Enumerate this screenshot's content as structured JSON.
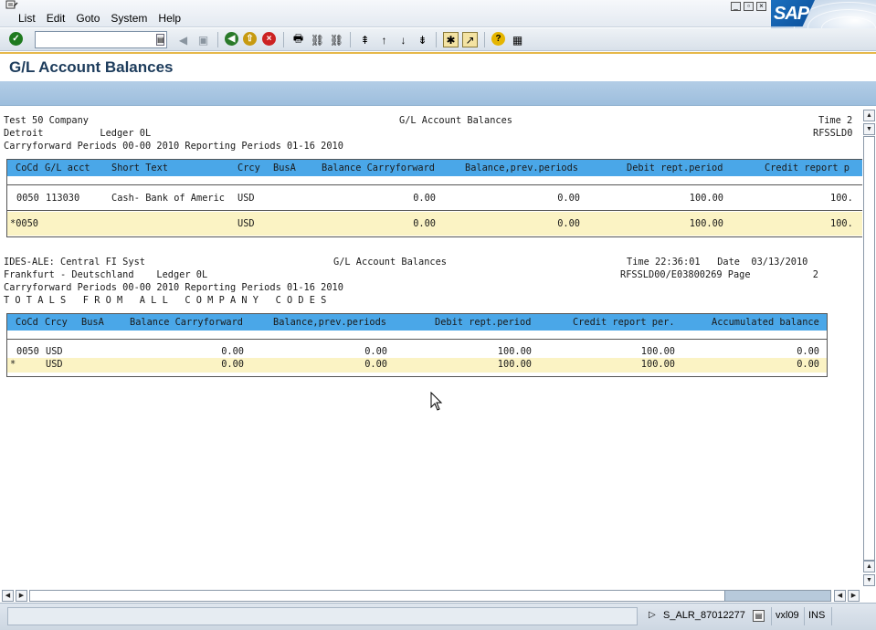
{
  "menubar": {
    "items": [
      "List",
      "Edit",
      "Goto",
      "System",
      "Help"
    ],
    "logo": "SAP"
  },
  "toolbar": {
    "command_value": "",
    "icons": [
      "enter-icon",
      "command-dropdown-icon",
      "back-triangle-icon",
      "save-icon",
      "back-icon",
      "exit-icon",
      "cancel-icon",
      "print-icon",
      "find-icon",
      "find-next-icon",
      "first-page-icon",
      "previous-page-icon",
      "next-page-icon",
      "last-page-icon",
      "create-session-icon",
      "shortcut-icon",
      "help-icon",
      "layout-icon"
    ]
  },
  "title": "G/L Account Balances",
  "report1": {
    "header_left": [
      "Test 50 Company",
      "Detroit          Ledger 0L",
      "Carryforward Periods 00-00 2010 Reporting Periods 01-16 2010"
    ],
    "header_center": "G/L Account Balances",
    "header_right": [
      "Time 2",
      "RFSSLD0"
    ],
    "columns": [
      "CoCd",
      "G/L acct",
      "Short Text",
      "Crcy",
      "BusA",
      "Balance Carryforward",
      "Balance,prev.periods",
      "Debit rept.period",
      "Credit report p"
    ],
    "rows": [
      {
        "cocd": "0050",
        "glacct": "113030",
        "short_text": "Cash- Bank of Americ",
        "crcy": "USD",
        "busa": "",
        "bal_cf": "0.00",
        "bal_prev": "0.00",
        "debit": "100.00",
        "credit": "100."
      }
    ],
    "total": {
      "cocd": "*0050",
      "crcy": "USD",
      "bal_cf": "0.00",
      "bal_prev": "0.00",
      "debit": "100.00",
      "credit": "100."
    }
  },
  "report2": {
    "header_left": [
      "IDES-ALE: Central FI Syst",
      "Frankfurt - Deutschland    Ledger 0L",
      "Carryforward Periods 00-00 2010 Reporting Periods 01-16 2010",
      "T O T A L S   F R O M   A L L   C O M P A N Y   C O D E S"
    ],
    "header_center": "G/L Account Balances",
    "time_line": "Time 22:36:01   Date  03/13/2010",
    "page_line": "RFSSLD00/E03800269 Page           2",
    "columns": [
      "CoCd",
      "Crcy",
      "BusA",
      "Balance Carryforward",
      "Balance,prev.periods",
      "Debit rept.period",
      "Credit report per.",
      "Accumulated balance"
    ],
    "rows": [
      {
        "cocd": "0050",
        "crcy": "USD",
        "busa": "",
        "bal_cf": "0.00",
        "bal_prev": "0.00",
        "debit": "100.00",
        "credit": "100.00",
        "accum": "0.00"
      }
    ],
    "total": {
      "cocd": "*",
      "crcy": "USD",
      "bal_cf": "0.00",
      "bal_prev": "0.00",
      "debit": "100.00",
      "credit": "100.00",
      "accum": "0.00"
    }
  },
  "statusbar": {
    "program": "S_ALR_87012277",
    "server": "vxl09",
    "mode": "INS"
  }
}
